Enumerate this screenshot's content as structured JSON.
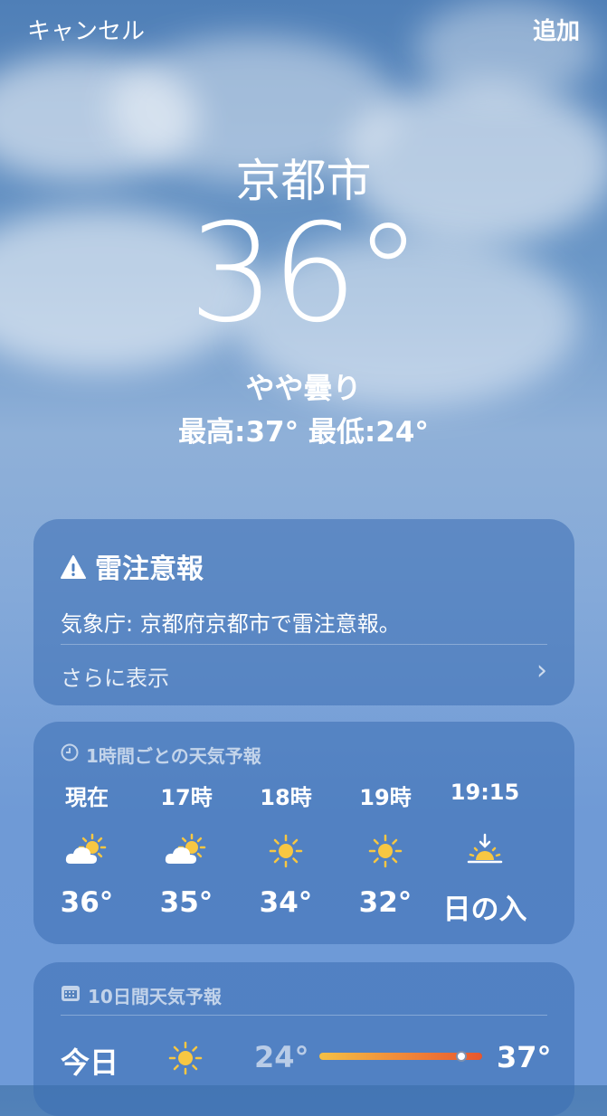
{
  "nav": {
    "cancel_label": "キャンセル",
    "add_label": "追加"
  },
  "weather": {
    "city": "京都市",
    "temperature": "36°",
    "condition": "やや曇り",
    "high_low": "最高:37°  最低:24°"
  },
  "alert": {
    "title": "雷注意報",
    "text": "気象庁: 京都府京都市で雷注意報。",
    "more_label": "さらに表示"
  },
  "hourly": {
    "label": "1時間ごとの天気予報",
    "items": [
      {
        "time": "現在",
        "icon": "partly-cloudy-sun-icon",
        "value": "36°"
      },
      {
        "time": "17時",
        "icon": "partly-cloudy-sun-icon",
        "value": "35°"
      },
      {
        "time": "18時",
        "icon": "sun-icon",
        "value": "34°"
      },
      {
        "time": "19時",
        "icon": "sun-icon",
        "value": "32°"
      },
      {
        "time": "19:15",
        "icon": "sunset-icon",
        "value": "日の入"
      }
    ]
  },
  "daily": {
    "label": "10日間天気予報",
    "days": [
      {
        "day": "今日",
        "icon": "sun-icon",
        "low": "24°",
        "high": "37°",
        "range_start": 0.0,
        "range_end": 1.0,
        "current": 0.87
      }
    ]
  },
  "colors": {
    "sun": "#f7c742",
    "bar_warm": "#e8572e",
    "bar_cool": "#f4c045"
  }
}
